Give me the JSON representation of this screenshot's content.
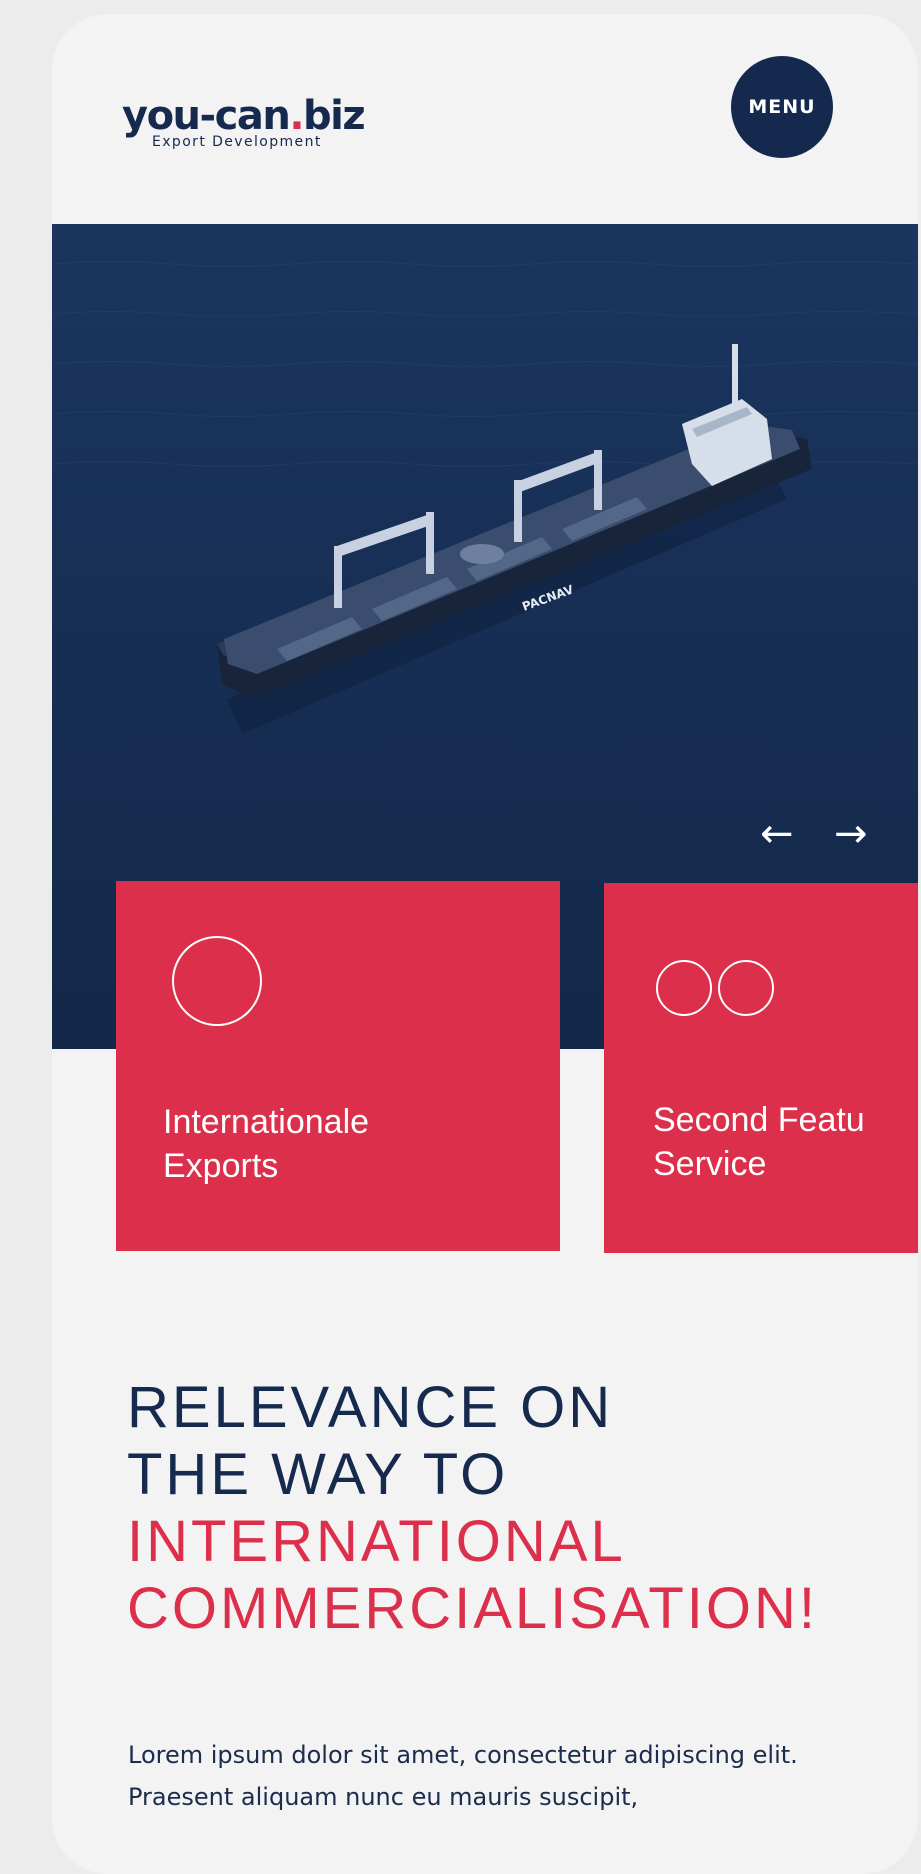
{
  "header": {
    "logo_main": "you-can",
    "logo_dot": ".",
    "logo_tld": "biz",
    "logo_sub": "Export Development",
    "menu_label": "MENU"
  },
  "hero": {
    "ship_name": "PACNAV",
    "prev_arrow": "←",
    "next_arrow": "→"
  },
  "cards": [
    {
      "title": "Internationale\nExports",
      "icon": "circle-icon"
    },
    {
      "title": "Second Featu\nService",
      "icon": "double-circle-icon"
    }
  ],
  "headline": {
    "line1": "RELEVANCE ON",
    "line2": "THE WAY TO",
    "line3": "INTERNATIONAL",
    "line4": "COMMERCIALISATION!"
  },
  "lead": "Lorem ipsum dolor sit amet, consectetur adipiscing elit. Praesent aliquam nunc eu mauris suscipit,",
  "colors": {
    "navy": "#142a4d",
    "red": "#dc2f4b",
    "background": "#f3f3f3"
  }
}
